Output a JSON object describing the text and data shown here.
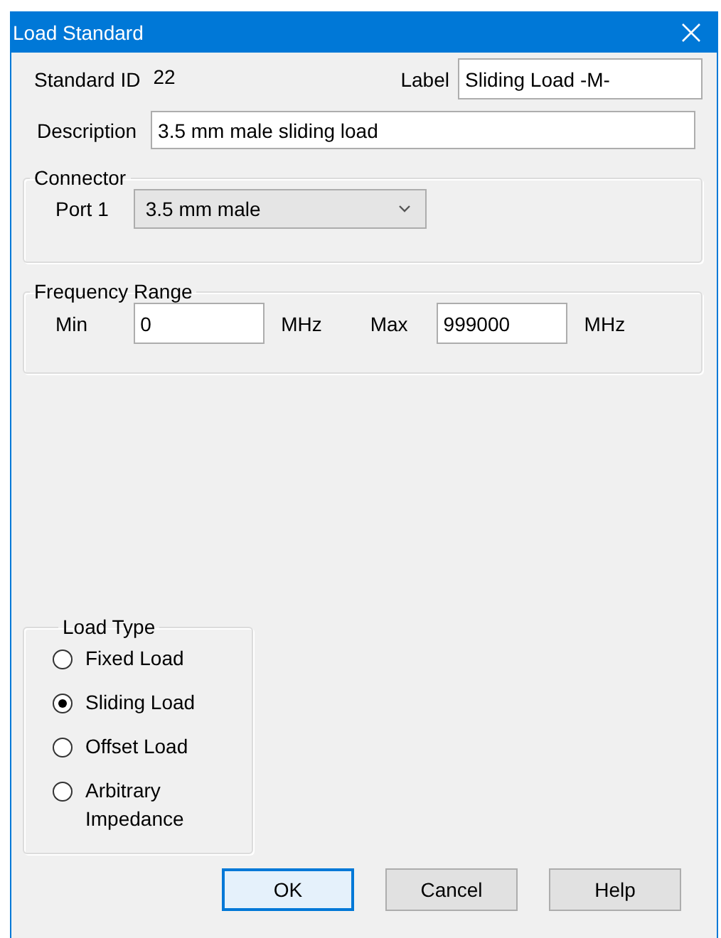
{
  "window": {
    "title": "Load Standard"
  },
  "standard_id": {
    "label": "Standard ID",
    "value": "22"
  },
  "label_field": {
    "label": "Label",
    "value": "Sliding Load -M-"
  },
  "description": {
    "label": "Description",
    "value": "3.5 mm male sliding load"
  },
  "connector": {
    "title": "Connector",
    "port_label": "Port 1",
    "value": "3.5 mm male"
  },
  "frequency_range": {
    "title": "Frequency Range",
    "min_label": "Min",
    "min_value": "0",
    "min_unit": "MHz",
    "max_label": "Max",
    "max_value": "999000",
    "max_unit": "MHz"
  },
  "load_type": {
    "title": "Load Type",
    "options": [
      {
        "label": "Fixed Load",
        "selected": false
      },
      {
        "label": "Sliding Load",
        "selected": true
      },
      {
        "label": "Offset Load",
        "selected": false
      },
      {
        "label": "Arbitrary Impedance",
        "selected": false
      }
    ]
  },
  "buttons": [
    {
      "label": "OK",
      "default": true
    },
    {
      "label": "Cancel",
      "default": false
    },
    {
      "label": "Help",
      "default": false
    }
  ]
}
